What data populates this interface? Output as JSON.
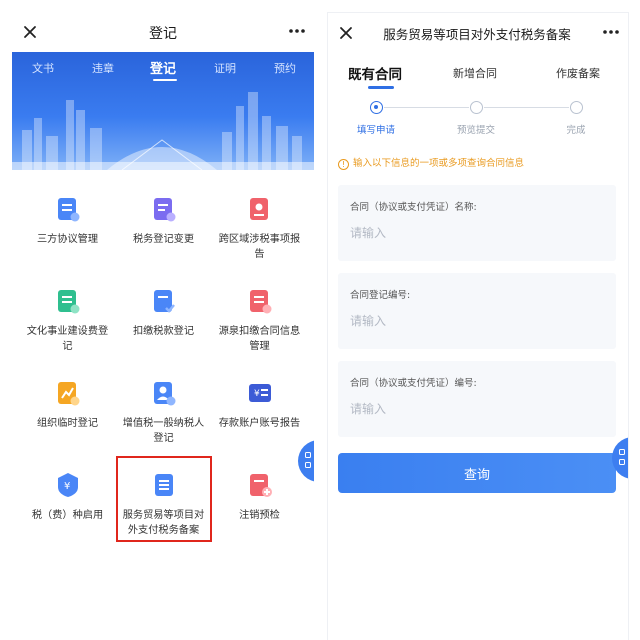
{
  "left": {
    "title": "登记",
    "nav_tabs": [
      "文书",
      "违章",
      "登记",
      "证明",
      "预约"
    ],
    "grid": [
      {
        "label": "三方协议管理",
        "icon": "document-list-icon",
        "color": "#4a86f7"
      },
      {
        "label": "税务登记变更",
        "icon": "document-edit-icon",
        "color": "#7b6cf0"
      },
      {
        "label": "跨区域涉税事项报告",
        "icon": "location-document-icon",
        "color": "#f0626b"
      },
      {
        "label": "文化事业建设费登记",
        "icon": "document-plus-icon",
        "color": "#2fbf8f"
      },
      {
        "label": "扣缴税款登记",
        "icon": "document-check-icon",
        "color": "#4a86f7"
      },
      {
        "label": "源泉扣缴合同信息管理",
        "icon": "document-shield-icon",
        "color": "#f0626b"
      },
      {
        "label": "组织临时登记",
        "icon": "chart-document-icon",
        "color": "#f5a623"
      },
      {
        "label": "增值税一般纳税人登记",
        "icon": "person-badge-icon",
        "color": "#4a86f7"
      },
      {
        "label": "存款账户账号报告",
        "icon": "bank-card-icon",
        "color": "#3c5bd6"
      },
      {
        "label": "税（费）种启用",
        "icon": "yen-shield-icon",
        "color": "#4a86f7"
      },
      {
        "label": "服务贸易等项目对外支付税务备案",
        "icon": "document-lines-icon",
        "color": "#4a86f7"
      },
      {
        "label": "注销预检",
        "icon": "medical-document-icon",
        "color": "#f0626b"
      }
    ]
  },
  "right": {
    "title": "服务贸易等项目对外支付税务备案",
    "tabs": [
      "既有合同",
      "新增合同",
      "作废备案"
    ],
    "steps": [
      "填写申请",
      "预览提交",
      "完成"
    ],
    "hint": "输入以下信息的一项或多项查询合同信息",
    "fields": [
      {
        "label": "合同（协议或支付凭证）名称:",
        "placeholder": "请输入"
      },
      {
        "label": "合同登记编号:",
        "placeholder": "请输入"
      },
      {
        "label": "合同（协议或支付凭证）编号:",
        "placeholder": "请输入"
      }
    ],
    "query_button": "查询"
  },
  "colors": {
    "primary": "#2f6fe4",
    "highlight": "#e0261c",
    "warning": "#e99a1f"
  }
}
